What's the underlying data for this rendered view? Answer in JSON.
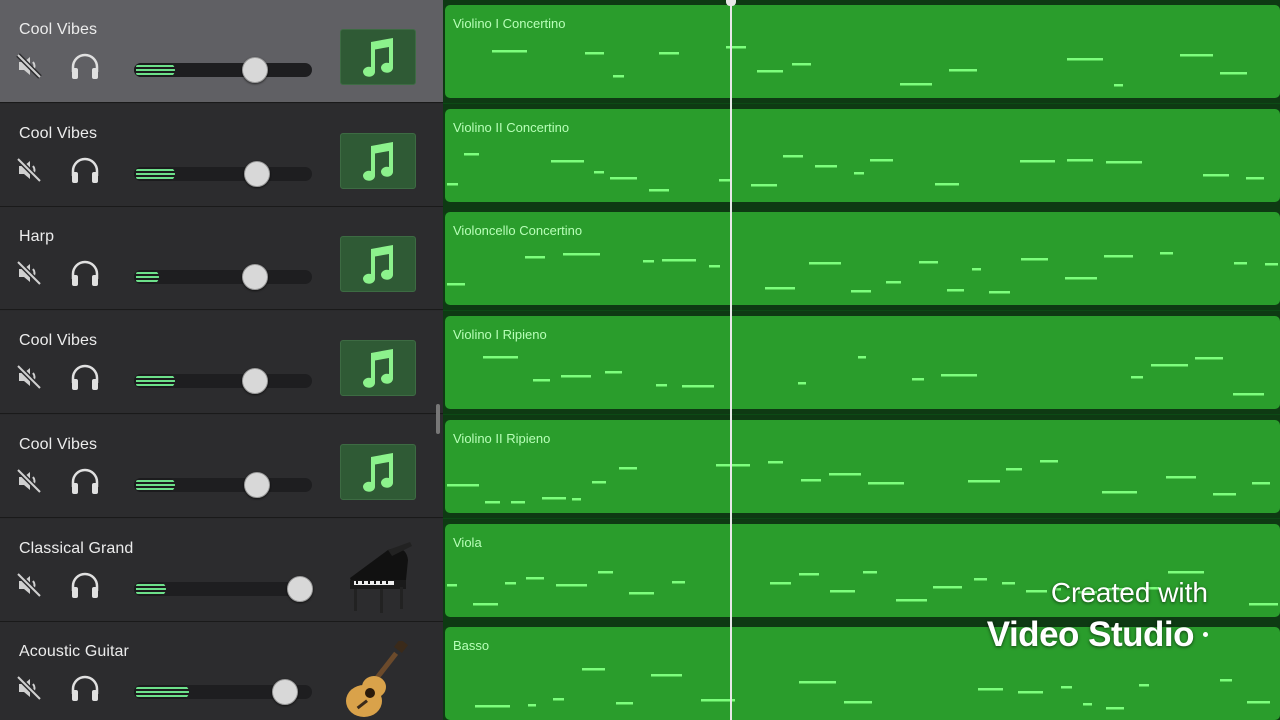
{
  "tracks": [
    {
      "name": "Cool Vibes",
      "instrument_icon": "music-note-icon",
      "volume": 0.23,
      "pan_knob": 0.68,
      "selected": true
    },
    {
      "name": "Cool Vibes",
      "instrument_icon": "music-note-icon",
      "volume": 0.23,
      "pan_knob": 0.69,
      "selected": false
    },
    {
      "name": "Harp",
      "instrument_icon": "music-note-icon",
      "volume": 0.14,
      "pan_knob": 0.68,
      "selected": false
    },
    {
      "name": "Cool Vibes",
      "instrument_icon": "music-note-icon",
      "volume": 0.23,
      "pan_knob": 0.68,
      "selected": false
    },
    {
      "name": "Cool Vibes",
      "instrument_icon": "music-note-icon",
      "volume": 0.23,
      "pan_knob": 0.69,
      "selected": false
    },
    {
      "name": "Classical Grand",
      "instrument_icon": "grand-piano-icon",
      "volume": 0.18,
      "pan_knob": 0.93,
      "selected": false
    },
    {
      "name": "Acoustic Guitar",
      "instrument_icon": "acoustic-guitar-icon",
      "volume": 0.31,
      "pan_knob": 0.85,
      "selected": false
    }
  ],
  "regions": [
    {
      "label": "Violino I Concertino"
    },
    {
      "label": "Violino II Concertino"
    },
    {
      "label": "Violoncello Concertino"
    },
    {
      "label": "Violino I Ripieno"
    },
    {
      "label": "Violino II Ripieno"
    },
    {
      "label": "Viola"
    },
    {
      "label": "Basso"
    }
  ],
  "watermark": {
    "line1": "Created with",
    "line2": "Video Studio"
  },
  "colors": {
    "region": "#2a9d2c",
    "note": "#7dff7d",
    "volume_fill": "#6de08a",
    "selected_header": "#606064"
  }
}
